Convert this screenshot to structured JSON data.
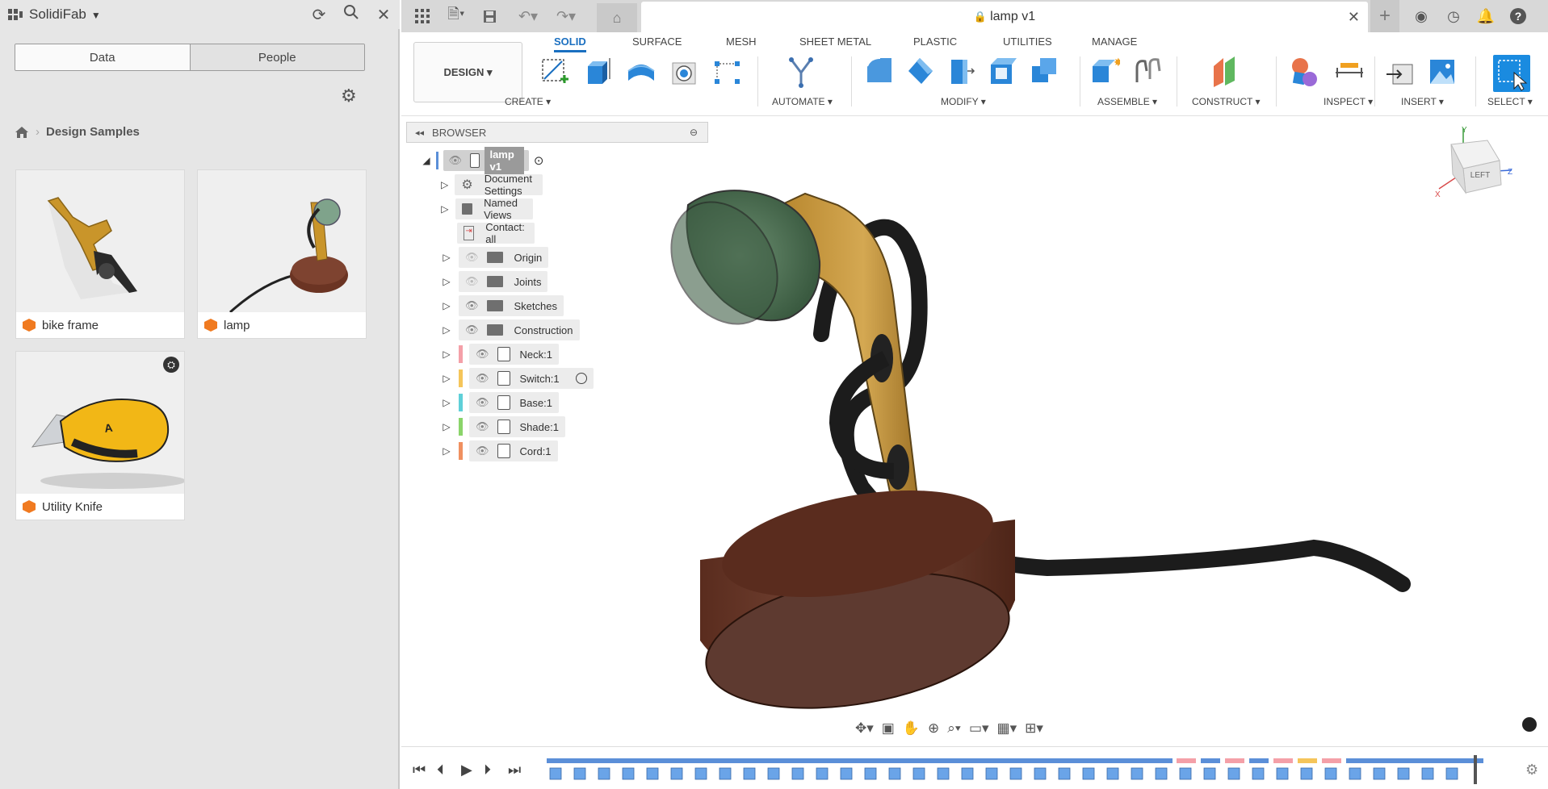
{
  "left_panel": {
    "app_name": "SolidiFab",
    "tabs": [
      "Data",
      "People"
    ],
    "breadcrumb": "Design Samples",
    "cards": [
      {
        "label": "bike frame"
      },
      {
        "label": "lamp"
      },
      {
        "label": "Utility Knife"
      }
    ]
  },
  "topbar": {
    "doc_title": "lamp v1"
  },
  "toolbar": {
    "workspace": "DESIGN ▾",
    "tabs": [
      "SOLID",
      "SURFACE",
      "MESH",
      "SHEET METAL",
      "PLASTIC",
      "UTILITIES",
      "MANAGE"
    ],
    "active_tab": "SOLID",
    "groups": [
      "CREATE ▾",
      "AUTOMATE ▾",
      "MODIFY ▾",
      "ASSEMBLE ▾",
      "CONSTRUCT ▾",
      "INSPECT ▾",
      "INSERT ▾",
      "SELECT ▾"
    ]
  },
  "browser": {
    "title": "BROWSER",
    "root": "lamp v1",
    "items": [
      {
        "label": "Document Settings"
      },
      {
        "label": "Named Views"
      },
      {
        "label": "Contact: all"
      },
      {
        "label": "Origin"
      },
      {
        "label": "Joints"
      },
      {
        "label": "Sketches"
      },
      {
        "label": "Construction"
      },
      {
        "label": "Neck:1",
        "color": "#f4a0a8"
      },
      {
        "label": "Switch:1",
        "color": "#f5c55a"
      },
      {
        "label": "Base:1",
        "color": "#5fd0d8"
      },
      {
        "label": "Shade:1",
        "color": "#8ad46a"
      },
      {
        "label": "Cord:1",
        "color": "#f09060"
      }
    ]
  },
  "viewcube": {
    "face_label": "LEFT",
    "axes": [
      "X",
      "Y",
      "Z"
    ]
  },
  "colors": {
    "accent": "#1a6fc0",
    "timeline": "#5b8fd8"
  }
}
